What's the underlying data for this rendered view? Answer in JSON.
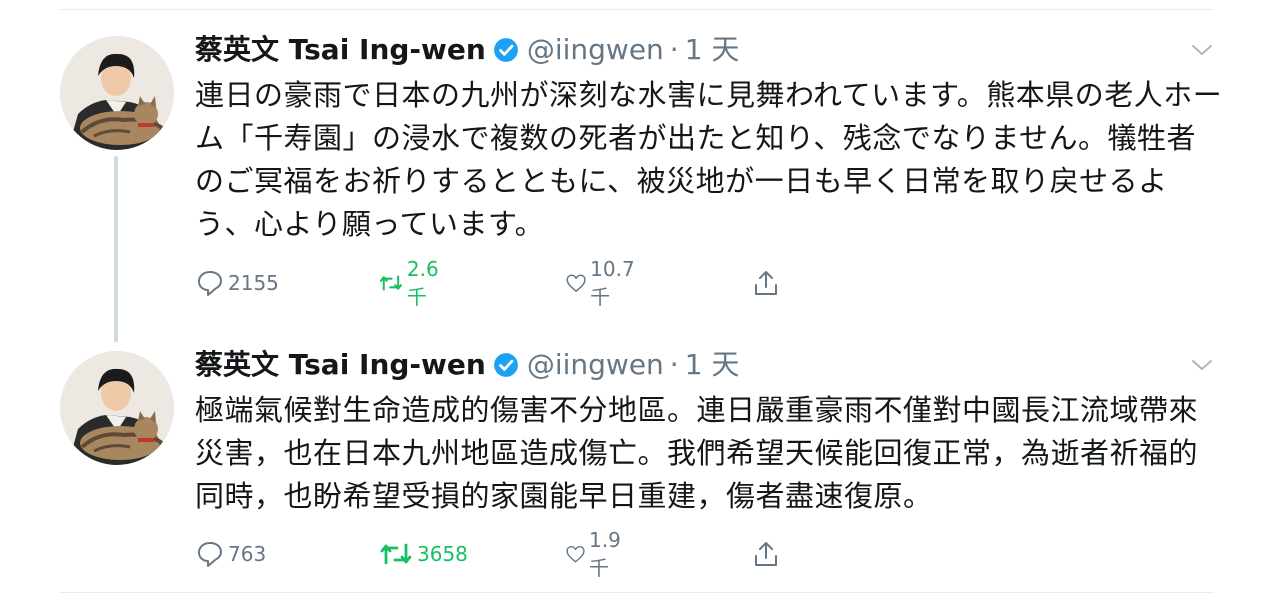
{
  "colors": {
    "text": "#14171a",
    "secondary": "#657786",
    "retweeted": "#17bf63",
    "verified": "#1da1f2",
    "divider": "#e6ecf0"
  },
  "tweets": [
    {
      "author_name": "蔡英文 Tsai Ing-wen",
      "verified_icon": "verified-badge-icon",
      "handle": "@iingwen",
      "separator": "·",
      "time": "1 天",
      "text": "連日の豪雨で日本の九州が深刻な水害に見舞われています。熊本県の老人ホーム「千寿園」の浸水で複数の死者が出たと知り、残念でなりません。犠牲者のご冥福をお祈りするとともに、被災地が一日も早く日常を取り戻せるよう、心より願っています。",
      "replies": "2155",
      "retweets": "2.6 千",
      "likes": "10.7 千"
    },
    {
      "author_name": "蔡英文 Tsai Ing-wen",
      "verified_icon": "verified-badge-icon",
      "handle": "@iingwen",
      "separator": "·",
      "time": "1 天",
      "text": "極端氣候對生命造成的傷害不分地區。連日嚴重豪雨不僅對中國長江流域帶來災害，也在日本九州地區造成傷亡。我們希望天候能回復正常，為逝者祈福的同時，也盼希望受損的家園能早日重建，傷者盡速復原。",
      "replies": "763",
      "retweets": "3658",
      "likes": "1.9 千"
    }
  ]
}
